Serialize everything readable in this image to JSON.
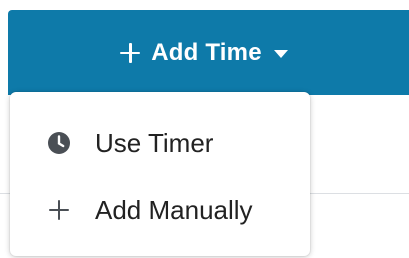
{
  "header": {
    "add_time_label": "Add Time"
  },
  "dropdown": {
    "items": [
      {
        "label": "Use Timer",
        "icon": "clock-icon"
      },
      {
        "label": "Add Manually",
        "icon": "plus-icon"
      }
    ]
  },
  "colors": {
    "accent": "#0e7aa9",
    "menu_text": "#222222",
    "icon": "#4a4f55"
  }
}
